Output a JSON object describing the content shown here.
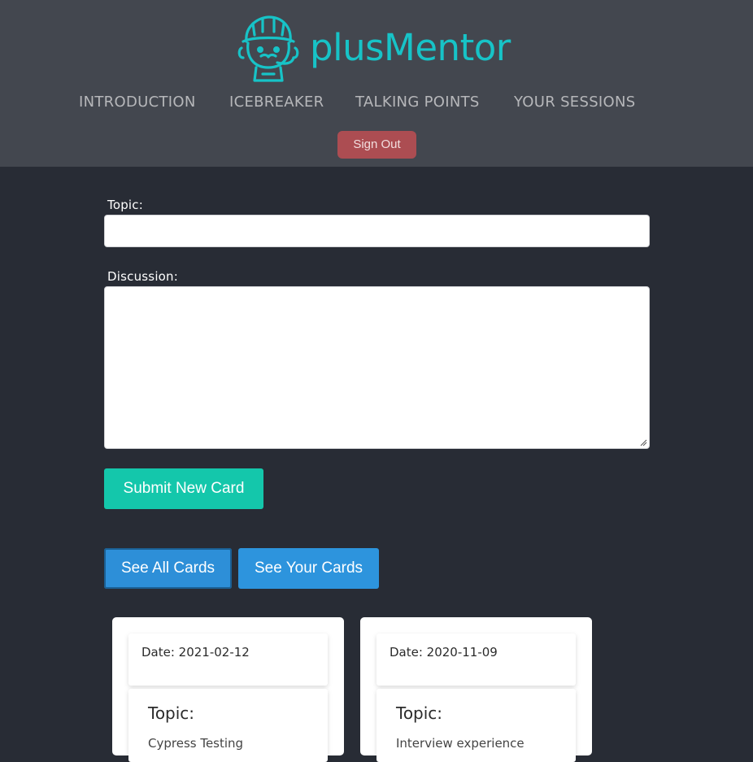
{
  "brand": {
    "name": "plusMentor",
    "logo_icon": "mentor-mascot-icon",
    "accent": "#17c3c7"
  },
  "nav": [
    {
      "label": "INTRODUCTION"
    },
    {
      "label": "ICEBREAKER"
    },
    {
      "label": "TALKING POINTS"
    },
    {
      "label": "YOUR SESSIONS"
    }
  ],
  "signout_label": "Sign Out",
  "form": {
    "topic_label": "Topic:",
    "topic_value": "",
    "discussion_label": "Discussion:",
    "discussion_value": "",
    "submit_label": "Submit New Card"
  },
  "filters": {
    "all_label": "See All Cards",
    "yours_label": "See Your Cards"
  },
  "cards": [
    {
      "date": "Date: 2021-02-12",
      "topic_label": "Topic:",
      "topic": "Cypress Testing"
    },
    {
      "date": "Date: 2020-11-09",
      "topic_label": "Topic:",
      "topic": "Interview experience"
    }
  ],
  "colors": {
    "header_bg": "#43474f",
    "page_bg": "#282c35",
    "signout": "#ac4d52",
    "submit": "#14c7ab",
    "filter": "#2d8fd8"
  }
}
